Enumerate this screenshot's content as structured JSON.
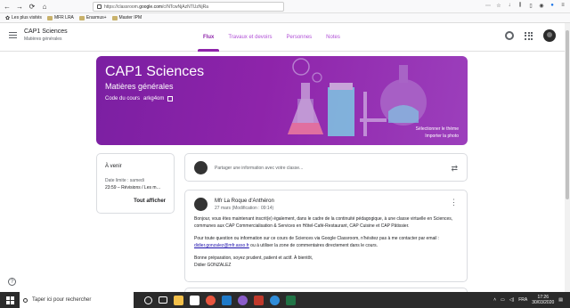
{
  "browser": {
    "url_prefix": "https://classroom.",
    "url_domain": "google.com",
    "url_suffix": "/c/NTcwNjAzNTUzNjRa",
    "bookmarks": [
      "Les plus visités",
      "MFR LRA",
      "Erasmus+",
      "Master IPM"
    ]
  },
  "header": {
    "course_title": "CAP1 Sciences",
    "course_subtitle": "Matières générales",
    "tabs": [
      {
        "label": "Flux"
      },
      {
        "label": "Travaux et devoirs"
      },
      {
        "label": "Personnes"
      },
      {
        "label": "Notes"
      }
    ]
  },
  "banner": {
    "title": "CAP1 Sciences",
    "subtitle": "Matières générales",
    "code_label": "Code du cours",
    "code_value": "arkg4om",
    "theme_select": "Sélectionner le thème",
    "theme_import": "Importer la photo"
  },
  "upcoming": {
    "heading": "À venir",
    "due": "Date limite : samedi",
    "item": "23:59 – Révisions / Les m…",
    "view_all": "Tout afficher"
  },
  "share": {
    "placeholder": "Partager une information avec votre classe..."
  },
  "post": {
    "author": "Mfr La Roque d'Anthéron",
    "date": "27 mars (Modification : 09:14)",
    "p1": "Bonjour, vous êtes maintenant inscrit(e) également, dans le cadre de la continuité pédagogique, à une classe virtuelle en Sciences, communes aux CAP Commercialisation & Services en Hôtel-Café-Restaurant, CAP Cuisine et CAP Pâtissier.",
    "p2_a": "Pour toute question ou information sur ce cours de Sciences via Google Classroom, n'hésitez pas à me contacter par email :",
    "p2_email": "didier.gonzalez@mfr.asso.fr",
    "p2_b": "ou à utiliser la zone de commentaires directement dans le cours.",
    "p3": "Bonne préparation, soyez prudent, patient et actif. À bientôt,",
    "p4": "Didier GONZALEZ"
  },
  "taskbar": {
    "search_placeholder": "Taper ici pour rechercher",
    "lang": "FRA",
    "time": "17:26",
    "date": "30/03/2020"
  },
  "colors": {
    "accent": "#8e24aa",
    "banner": "#8e24aa"
  }
}
